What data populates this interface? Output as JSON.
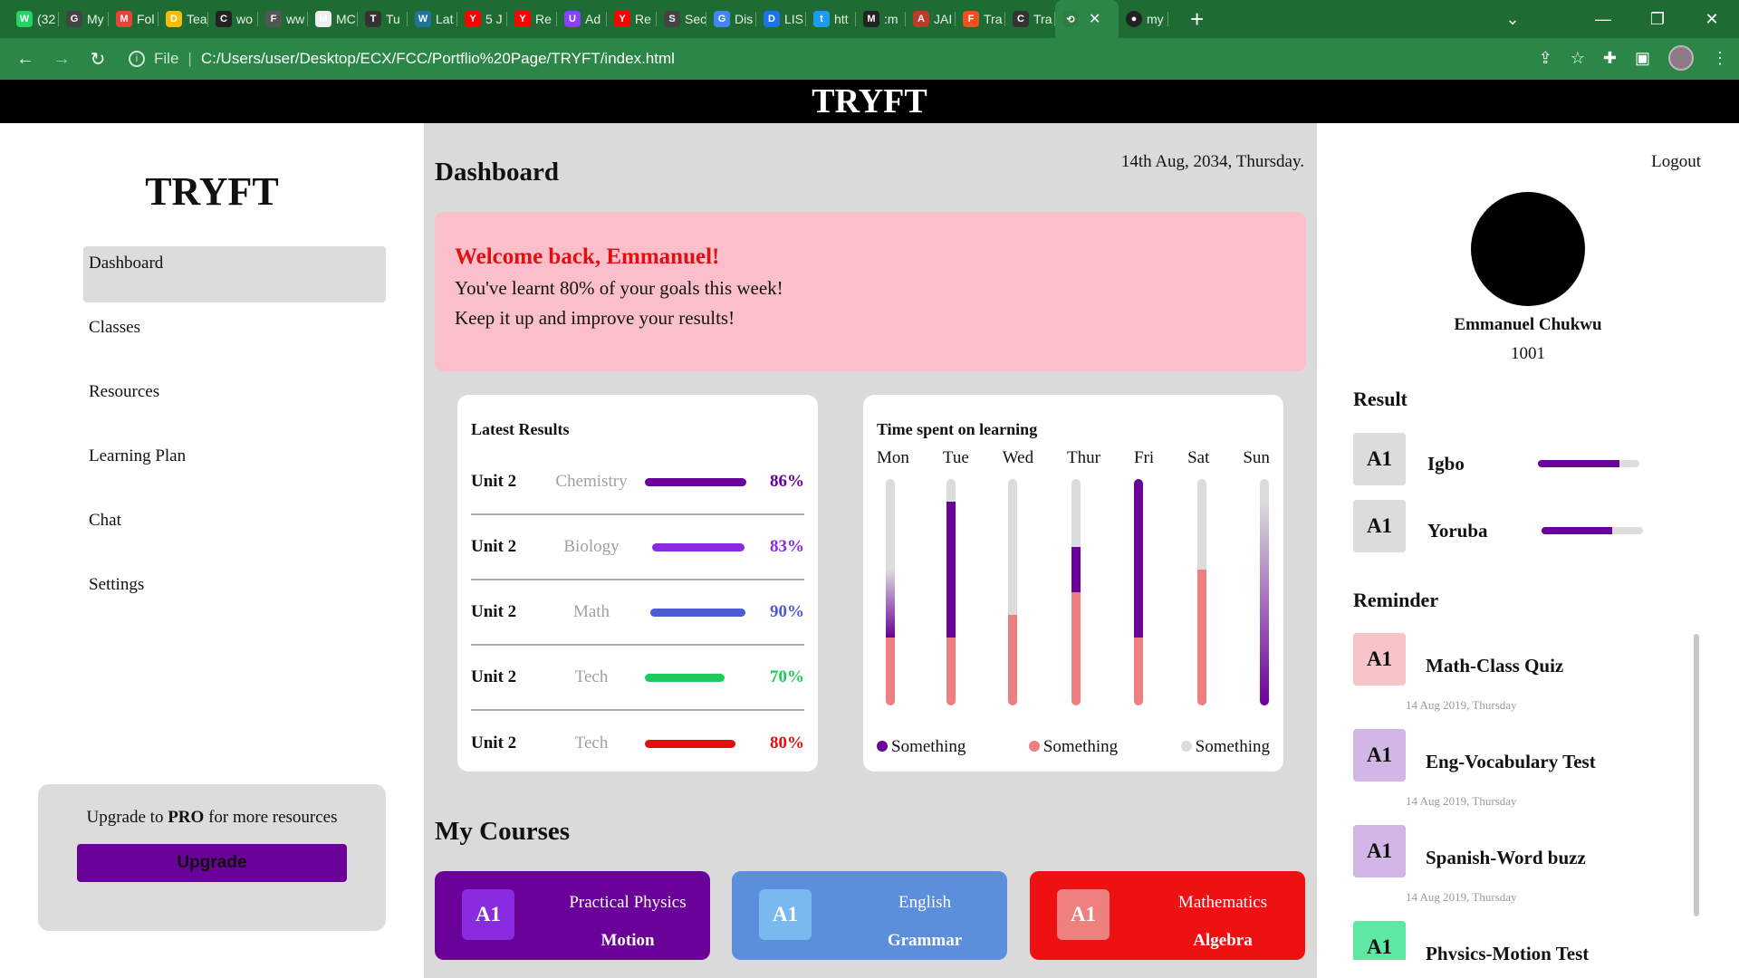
{
  "browser": {
    "tabs": [
      {
        "label": "(32",
        "color": "#25d366",
        "glyph": "W"
      },
      {
        "label": "My",
        "color": "#444444",
        "glyph": "G"
      },
      {
        "label": "Fol",
        "color": "#ea4335",
        "glyph": "M"
      },
      {
        "label": "Tea",
        "color": "#fbbc04",
        "glyph": "D"
      },
      {
        "label": "wo",
        "color": "#222222",
        "glyph": "C"
      },
      {
        "label": "ww",
        "color": "#555555",
        "glyph": "F"
      },
      {
        "label": "MC",
        "color": "#eeeeee",
        "glyph": "M"
      },
      {
        "label": "Tu",
        "color": "#333333",
        "glyph": "T"
      },
      {
        "label": "Lat",
        "color": "#21759b",
        "glyph": "W"
      },
      {
        "label": "5 J",
        "color": "#ff0000",
        "glyph": "Y"
      },
      {
        "label": "Re",
        "color": "#ff0000",
        "glyph": "Y"
      },
      {
        "label": "Ad",
        "color": "#8a3ffc",
        "glyph": "U"
      },
      {
        "label": "Re",
        "color": "#ff0000",
        "glyph": "Y"
      },
      {
        "label": "Sec",
        "color": "#444444",
        "glyph": "S"
      },
      {
        "label": "Dis",
        "color": "#4285f4",
        "glyph": "G"
      },
      {
        "label": "LIS",
        "color": "#1a73e8",
        "glyph": "D"
      },
      {
        "label": "htt",
        "color": "#1d9bf0",
        "glyph": "t"
      },
      {
        "label": ":m",
        "color": "#222222",
        "glyph": "M"
      },
      {
        "label": "JAI",
        "color": "#c0392b",
        "glyph": "A"
      },
      {
        "label": "Tra",
        "color": "#f24e1e",
        "glyph": "F"
      },
      {
        "label": "Tra",
        "color": "#333333",
        "glyph": "C"
      }
    ],
    "active_tab": {
      "label": "",
      "glyph": "G"
    },
    "last_tab": {
      "label": "my",
      "glyph": "GH"
    },
    "new_tab": "+",
    "file_label": "File",
    "url": "C:/Users/user/Desktop/ECX/FCC/Portflio%20Page/TRYFT/index.html"
  },
  "banner": {
    "title": "TRYFT"
  },
  "sidebar": {
    "logo": "TRYFT",
    "items": [
      {
        "label": "Dashboard",
        "active": true
      },
      {
        "label": "Classes"
      },
      {
        "label": "Resources"
      },
      {
        "label": "Learning Plan"
      },
      {
        "label": "Chat"
      },
      {
        "label": "Settings"
      }
    ],
    "upgrade": {
      "text_before": "Upgrade to ",
      "text_bold": "PRO",
      "text_after": " for more resources",
      "button": "Upgrade"
    }
  },
  "main": {
    "title": "Dashboard",
    "date": "14th Aug, 2034, Thursday.",
    "welcome": {
      "greeting": "Welcome back, Emmanuel!",
      "line1": "You've learnt 80% of your goals this week!",
      "line2": "Keep it up and improve your results!"
    },
    "latest_results": {
      "title": "Latest Results",
      "rows": [
        {
          "unit": "Unit 2",
          "subject": "Chemistry",
          "percent": "86%",
          "color": "#6a0199"
        },
        {
          "unit": "Unit 2",
          "subject": "Biology",
          "percent": "83%",
          "color": "#8a2be2"
        },
        {
          "unit": "Unit 2",
          "subject": "Math",
          "percent": "90%",
          "color": "#4a5bd4"
        },
        {
          "unit": "Unit 2",
          "subject": "Tech",
          "percent": "70%",
          "color": "#1ecb5a"
        },
        {
          "unit": "Unit 2",
          "subject": "Tech",
          "percent": "80%",
          "color": "#e01010"
        }
      ]
    },
    "time_spent": {
      "title": "Time spent on learning",
      "days": [
        "Mon",
        "Tue",
        "Wed",
        "Thur",
        "Fri",
        "Sat",
        "Sun"
      ],
      "legend": [
        {
          "label": "Something",
          "color": "#6a0199"
        },
        {
          "label": "Something",
          "color": "#ee7f81"
        },
        {
          "label": "Something",
          "color": "#dcdcdc"
        }
      ]
    },
    "courses_title": "My Courses",
    "courses": [
      {
        "badge": "A1",
        "title": "Practical Physics",
        "subtitle": "Motion",
        "color": "#6a0199",
        "badge_color": "#8a2be2"
      },
      {
        "badge": "A1",
        "title": "English",
        "subtitle": "Grammar",
        "color": "#5b8fdc",
        "badge_color": "#7ab8f0"
      },
      {
        "badge": "A1",
        "title": "Mathematics",
        "subtitle": "Algebra",
        "color": "#ee1111",
        "badge_color": "#ef8080"
      }
    ]
  },
  "profile": {
    "logout": "Logout",
    "name": "Emmanuel Chukwu",
    "id": "1001",
    "result_title": "Result",
    "results": [
      {
        "badge": "A1",
        "language": "Igbo",
        "progress": 0.8
      },
      {
        "badge": "A1",
        "language": "Yoruba",
        "progress": 0.7
      }
    ],
    "reminder_title": "Reminder",
    "reminders": [
      {
        "badge": "A1",
        "name": "Math-Class Quiz",
        "when": "14 Aug 2019, Thursday",
        "color": "#f6c4c6"
      },
      {
        "badge": "A1",
        "name": "Eng-Vocabulary Test",
        "when": "14 Aug 2019, Thursday",
        "color": "#d2b6e6"
      },
      {
        "badge": "A1",
        "name": "Spanish-Word buzz",
        "when": "14 Aug 2019, Thursday",
        "color": "#d2b6e6"
      },
      {
        "badge": "A1",
        "name": "Physics-Motion Test",
        "when": "",
        "color": "#5ee8a4"
      }
    ]
  },
  "chart_data": {
    "type": "bar",
    "title": "Time spent on learning",
    "categories": [
      "Mon",
      "Tue",
      "Wed",
      "Thur",
      "Fri",
      "Sat",
      "Sun"
    ],
    "series": [
      {
        "name": "Something",
        "color": "#6a0199",
        "values": [
          0.3,
          0.6,
          0,
          0.2,
          0.7,
          0,
          0.9
        ]
      },
      {
        "name": "Something",
        "color": "#ee7f81",
        "values": [
          0.3,
          0.3,
          0.4,
          0.5,
          0.3,
          0.6,
          0
        ]
      },
      {
        "name": "Something",
        "color": "#dcdcdc",
        "values": [
          0.4,
          0.1,
          0.6,
          0.3,
          0,
          0.4,
          0.1
        ]
      }
    ],
    "ylim": [
      0,
      1
    ]
  }
}
